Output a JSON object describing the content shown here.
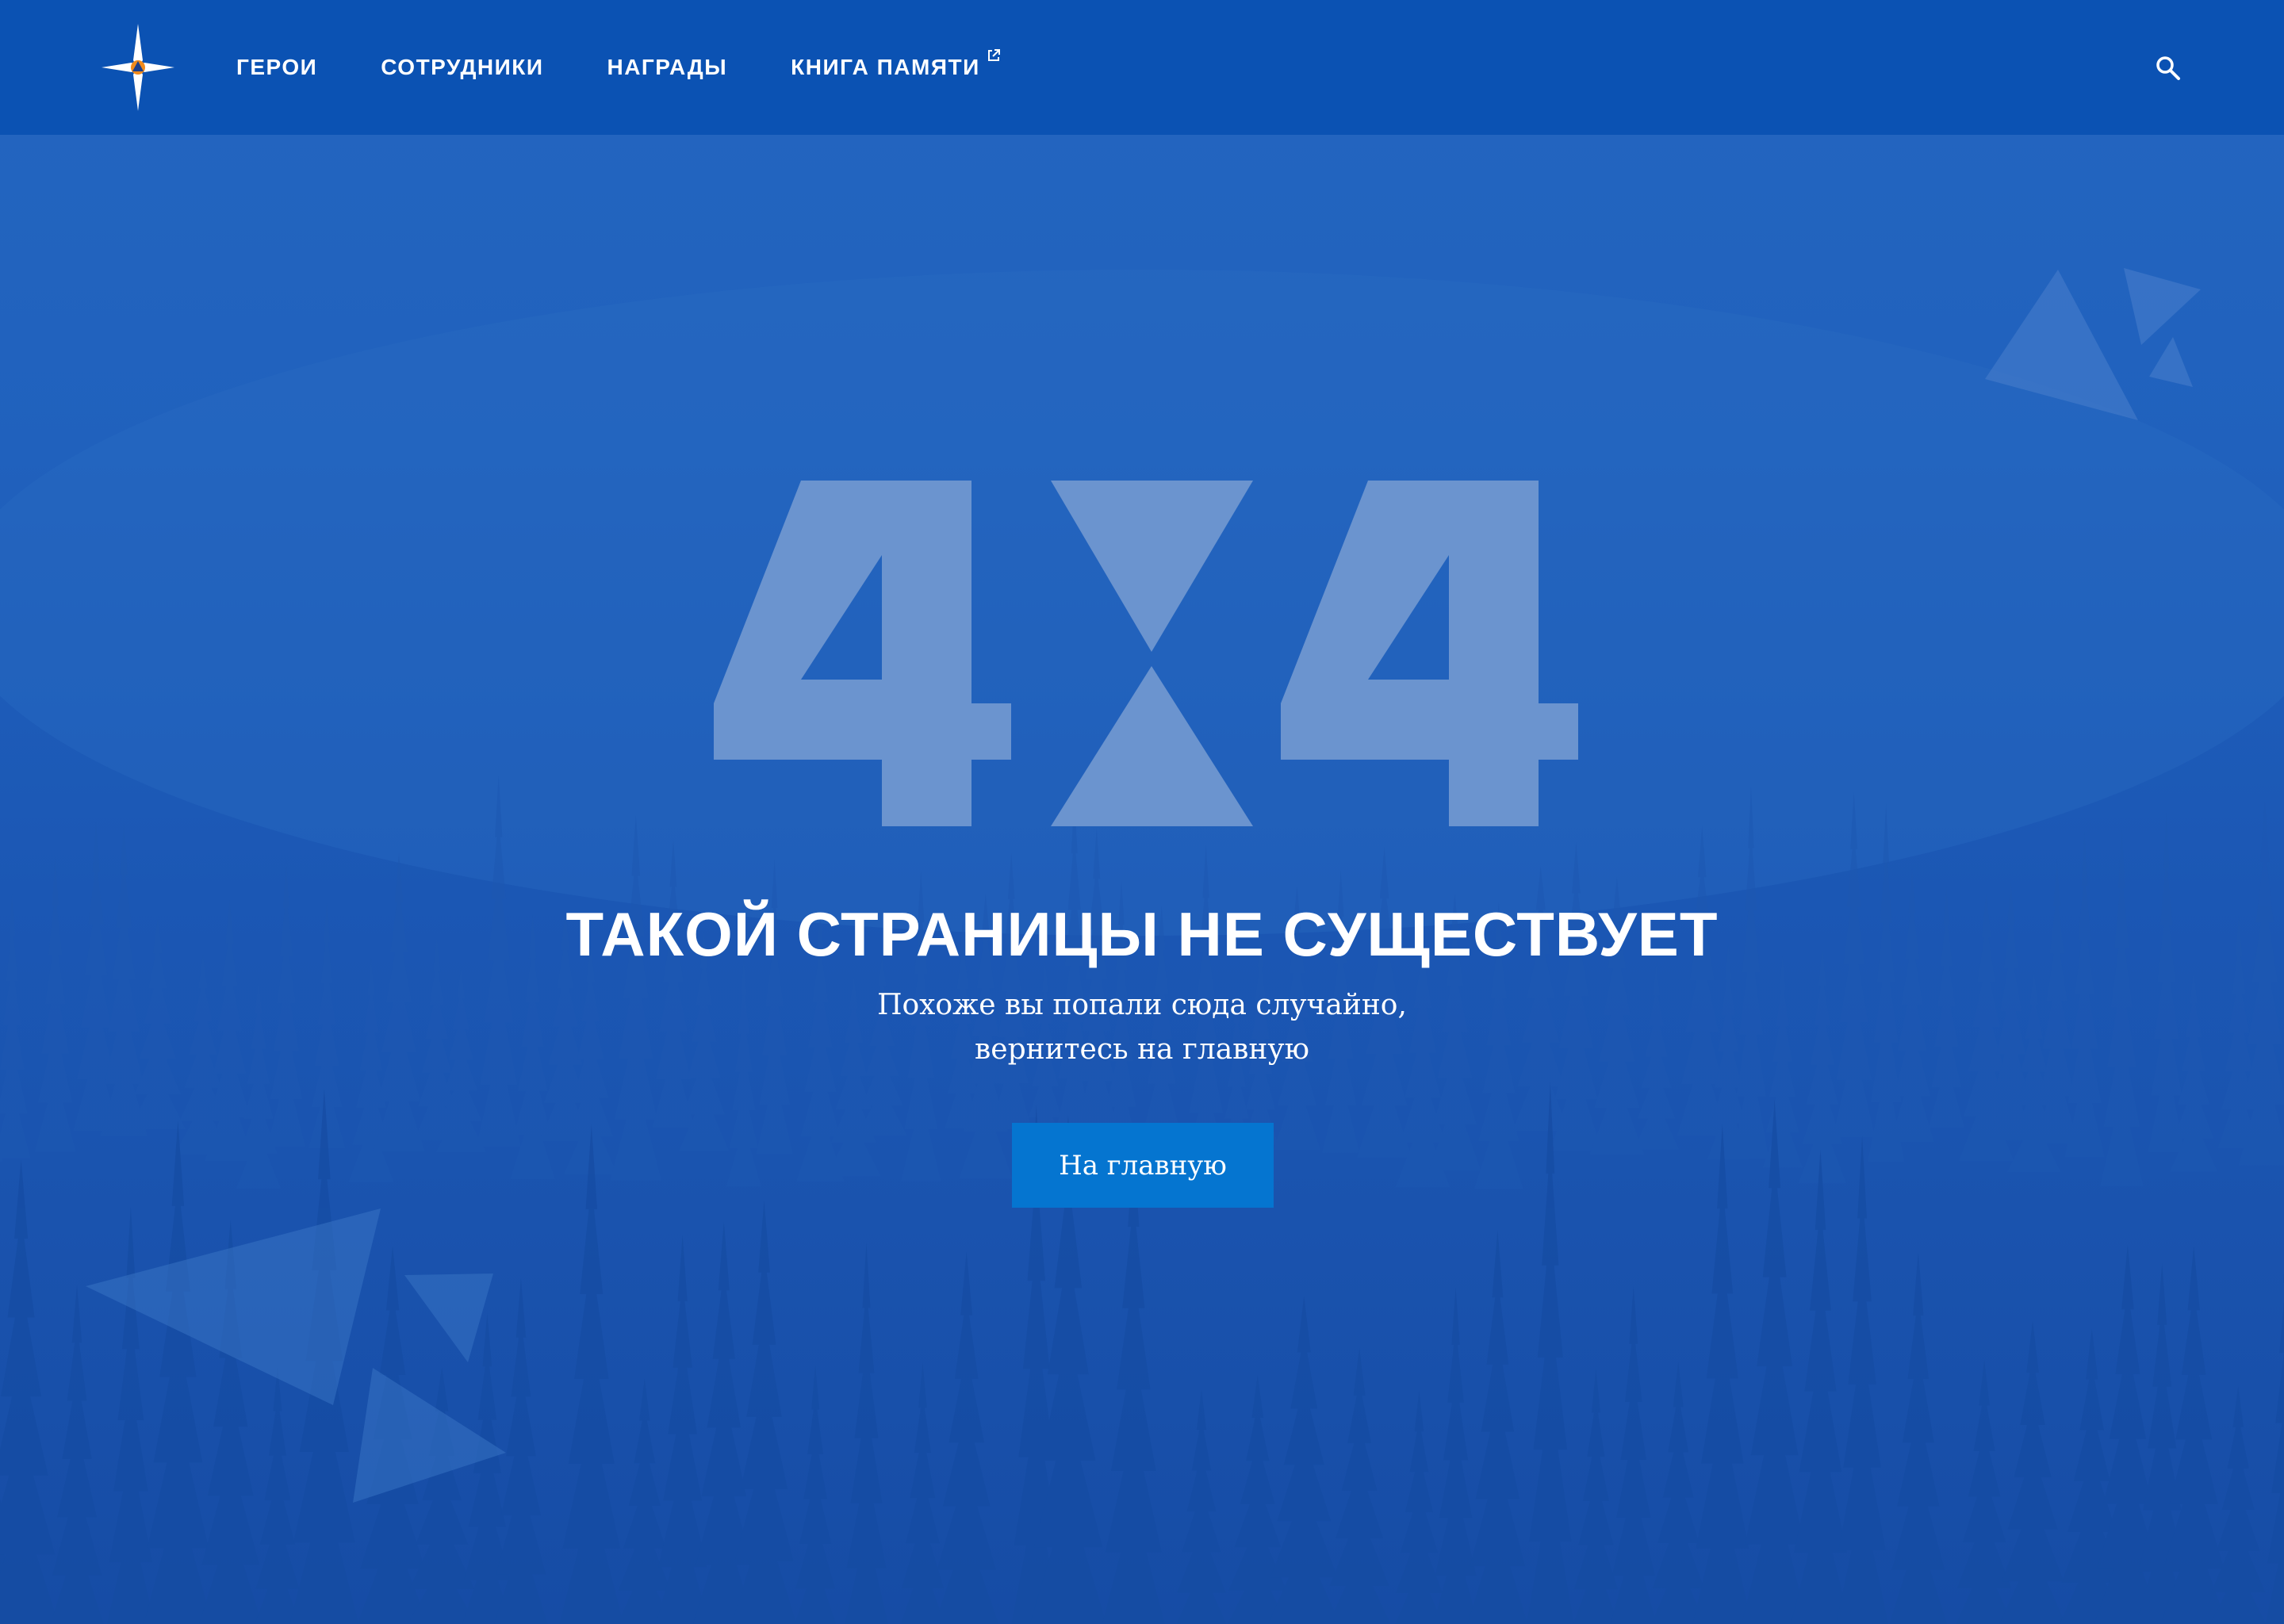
{
  "header": {
    "nav": [
      {
        "label": "ГЕРОИ"
      },
      {
        "label": "СОТРУДНИКИ"
      },
      {
        "label": "НАГРАДЫ"
      },
      {
        "label": "КНИГА ПАМЯТИ",
        "external": true
      }
    ],
    "search_icon": "search-icon",
    "logo_icon": "emergency-star-logo"
  },
  "error": {
    "code": "404",
    "title": "ТАКОЙ СТРАНИЦЫ НЕ СУЩЕСТВУЕТ",
    "subtitle_line1": "Похоже вы попали сюда случайно,",
    "subtitle_line2": "вернитесь на главную",
    "button_label": "На главную"
  },
  "colors": {
    "header_bg": "#0b52b3",
    "page_bg": "#1c5ab8",
    "button_bg": "#0575d0",
    "code_fill": "#6b94cf",
    "logo_accent": "#f08a1c"
  }
}
